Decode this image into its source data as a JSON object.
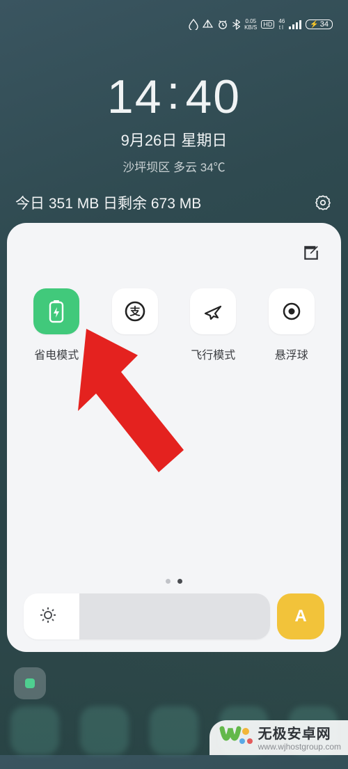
{
  "status": {
    "speed_top": "0.05",
    "speed_bottom": "KB/S",
    "net_badge": "HD",
    "net_type_top": "46",
    "net_type_bottom": "tl",
    "battery_pct": "34"
  },
  "clock": {
    "time_h": "14",
    "time_m": "40",
    "date": "9月26日  星期日",
    "weather": "沙坪坝区 多云 34℃"
  },
  "data_usage": {
    "text": "今日 351 MB 日剩余 673 MB"
  },
  "qs": {
    "tiles": [
      {
        "name": "power-save",
        "label": "省电模式",
        "active": true
      },
      {
        "name": "alipay",
        "label": "",
        "active": false
      },
      {
        "name": "airplane",
        "label": "飞行模式",
        "active": false
      },
      {
        "name": "float-ball",
        "label": "悬浮球",
        "active": false
      }
    ],
    "auto_label": "A"
  },
  "watermark": {
    "title": "无极安卓网",
    "url": "www.wjhostgroup.com"
  }
}
